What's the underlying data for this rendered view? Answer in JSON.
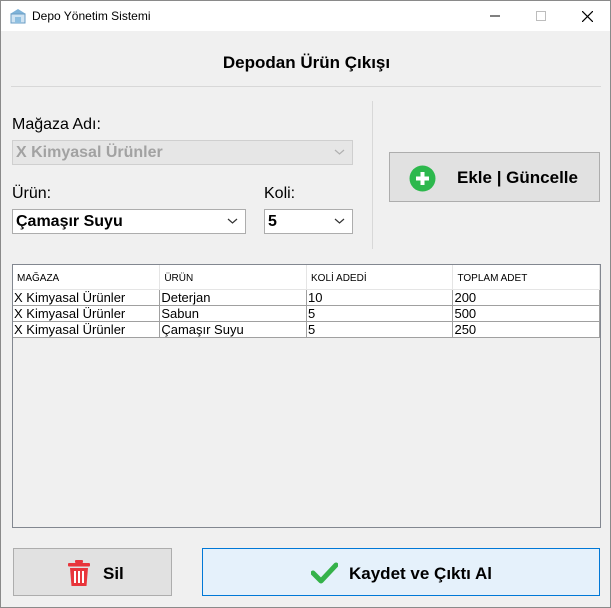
{
  "window": {
    "title": "Depo Yönetim Sistemi",
    "controls": {
      "minimize": "—",
      "maximize": "☐",
      "close": "✕"
    }
  },
  "heading": "Depodan Ürün Çıkışı",
  "form": {
    "store_label": "Mağaza Adı:",
    "store_value": "X Kimyasal Ürünler",
    "product_label": "Ürün:",
    "product_value": "Çamaşır Suyu",
    "koli_label": "Koli:",
    "koli_value": "5"
  },
  "buttons": {
    "add_update": "Ekle | Güncelle",
    "delete": "Sil",
    "save_print": "Kaydet ve Çıktı Al"
  },
  "table": {
    "columns": [
      "MAĞAZA",
      "ÜRÜN",
      "KOLİ ADEDİ",
      "TOPLAM ADET"
    ],
    "rows": [
      [
        "X Kimyasal Ürünler",
        "Deterjan",
        "10",
        "200"
      ],
      [
        "X Kimyasal Ürünler",
        "Sabun",
        "5",
        "500"
      ],
      [
        "X Kimyasal Ürünler",
        "Çamaşır Suyu",
        "5",
        "250"
      ]
    ]
  },
  "colors": {
    "add_icon": "#2db84d",
    "delete_icon": "#e8353b",
    "check_icon": "#35b24a",
    "primary_border": "#0078d7"
  },
  "icons": {
    "app": "warehouse-icon",
    "add": "plus-circle-icon",
    "delete": "trash-icon",
    "save": "checkmark-icon"
  }
}
